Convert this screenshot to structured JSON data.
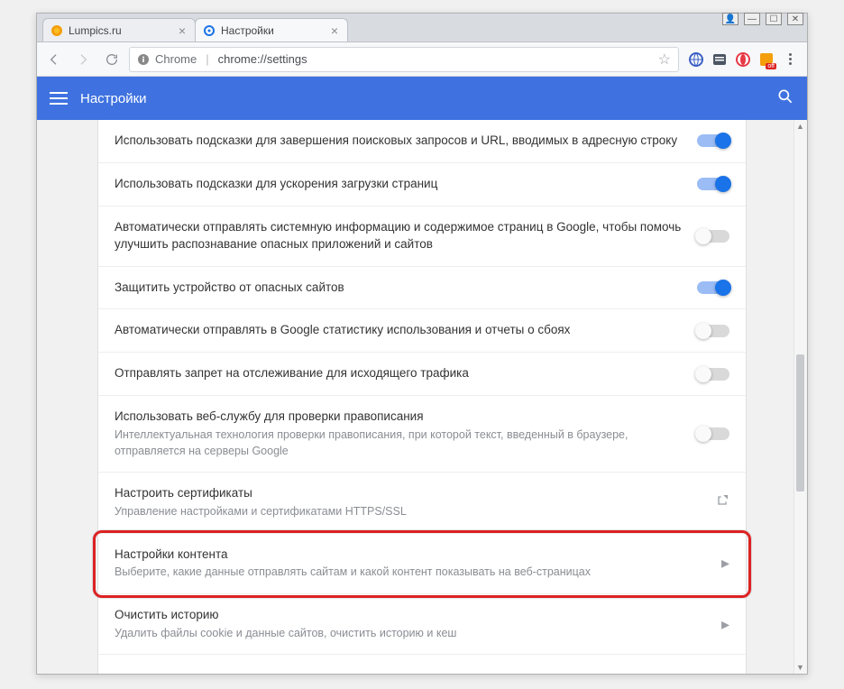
{
  "window_buttons": {
    "user": "👤",
    "min": "—",
    "max": "☐",
    "close": "✕"
  },
  "tabs": [
    {
      "title": "Lumpics.ru",
      "active": false,
      "favicon": "orange"
    },
    {
      "title": "Настройки",
      "active": true,
      "favicon": "gear"
    }
  ],
  "omnibox": {
    "scheme_label": "Chrome",
    "url_path": "chrome://settings"
  },
  "ext_off_label": "off",
  "app": {
    "title": "Настройки"
  },
  "rows": [
    {
      "title": "Использовать подсказки для завершения поисковых запросов и URL, вводимых в адресную строку",
      "sub": "",
      "ctrl": "toggle-on"
    },
    {
      "title": "Использовать подсказки для ускорения загрузки страниц",
      "sub": "",
      "ctrl": "toggle-on"
    },
    {
      "title": "Автоматически отправлять системную информацию и содержимое страниц в Google, чтобы помочь улучшить распознавание опасных приложений и сайтов",
      "sub": "",
      "ctrl": "toggle-off"
    },
    {
      "title": "Защитить устройство от опасных сайтов",
      "sub": "",
      "ctrl": "toggle-on"
    },
    {
      "title": "Автоматически отправлять в Google статистику использования и отчеты о сбоях",
      "sub": "",
      "ctrl": "toggle-off"
    },
    {
      "title": "Отправлять запрет на отслеживание для исходящего трафика",
      "sub": "",
      "ctrl": "toggle-off"
    },
    {
      "title": "Использовать веб-службу для проверки правописания",
      "sub": "Интеллектуальная технология проверки правописания, при которой текст, введенный в браузере, отправляется на серверы Google",
      "ctrl": "toggle-off"
    },
    {
      "title": "Настроить сертификаты",
      "sub": "Управление настройками и сертификатами HTTPS/SSL",
      "ctrl": "extlink"
    },
    {
      "title": "Настройки контента",
      "sub": "Выберите, какие данные отправлять сайтам и какой контент показывать на веб-страницах",
      "ctrl": "chevron"
    },
    {
      "title": "Очистить историю",
      "sub": "Удалить файлы cookie и данные сайтов, очистить историю и кеш",
      "ctrl": "chevron"
    }
  ]
}
